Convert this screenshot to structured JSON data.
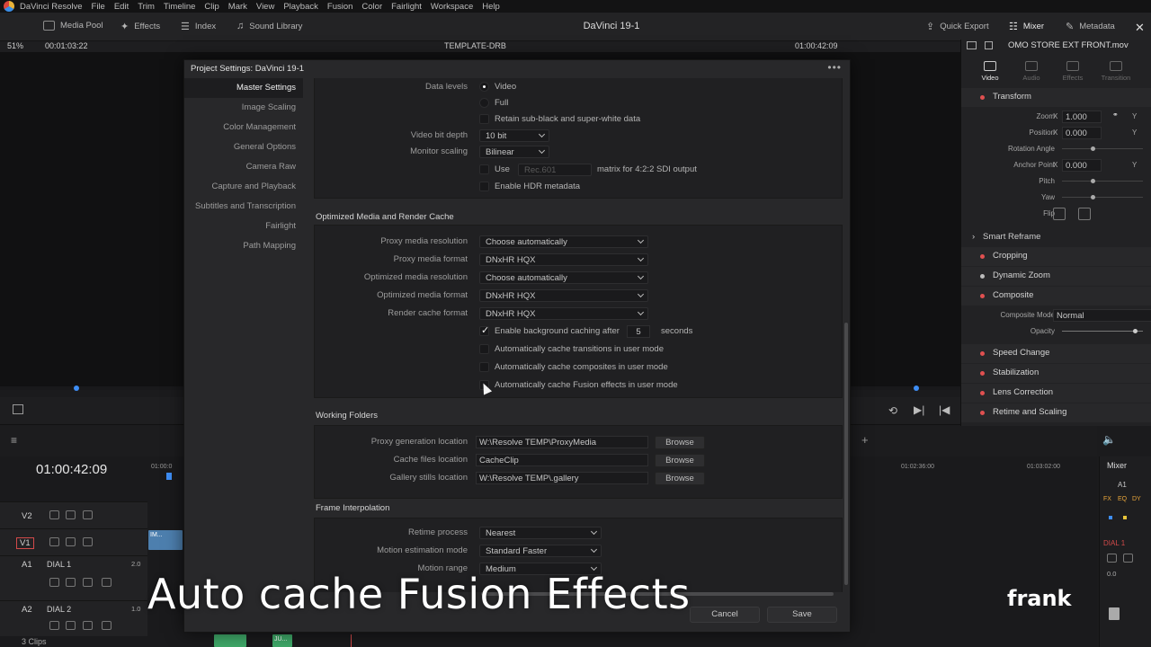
{
  "menubar": {
    "app_name": "DaVinci Resolve",
    "items": [
      "File",
      "Edit",
      "Trim",
      "Timeline",
      "Clip",
      "Mark",
      "View",
      "Playback",
      "Fusion",
      "Color",
      "Fairlight",
      "Workspace",
      "Help"
    ]
  },
  "toolbar": {
    "media_pool": "Media Pool",
    "effects": "Effects",
    "index": "Index",
    "sound_library": "Sound Library",
    "project_title": "DaVinci 19-1",
    "quick_export": "Quick Export",
    "mixer": "Mixer",
    "metadata": "Metadata"
  },
  "viewer": {
    "zoom": "51%",
    "timecode_left": "00:01:03:22",
    "timeline_name": "TEMPLATE-DRB",
    "timecode_right": "01:00:42:09",
    "clip_name": "OMO STORE EXT FRONT.mov"
  },
  "inspector": {
    "tabs": [
      "Video",
      "Audio",
      "Effects",
      "Transition"
    ],
    "transform": "Transform",
    "zoom_label": "Zoom",
    "zoom_x": "1.000",
    "position_label": "Position",
    "position_x": "0.000",
    "rotation_label": "Rotation Angle",
    "anchor_label": "Anchor Point",
    "anchor_x": "0.000",
    "pitch_label": "Pitch",
    "yaw_label": "Yaw",
    "flip_label": "Flip",
    "x_label": "X",
    "y_label": "Y",
    "smart_reframe": "Smart Reframe",
    "cropping": "Cropping",
    "dynamic_zoom": "Dynamic Zoom",
    "composite": "Composite",
    "composite_mode_label": "Composite Mode",
    "composite_mode": "Normal",
    "opacity_label": "Opacity",
    "speed_change": "Speed Change",
    "stabilization": "Stabilization",
    "lens_correction": "Lens Correction",
    "retime_scaling": "Retime and Scaling"
  },
  "timeline": {
    "timecode": "01:00:42:09",
    "ruler": [
      "01:00:0",
      "01:02:36:00",
      "01:03:02:00"
    ],
    "tracks": {
      "v2": "V2",
      "v1": "V1",
      "a1": "A1",
      "a1_name": "DIAL 1",
      "a1_level": "2.0",
      "a2": "A2",
      "a2_name": "DIAL 2",
      "a2_level": "1.0",
      "clips_count": "3 Clips"
    },
    "clip_label": "IM...",
    "audio_clip_label": "JU..."
  },
  "mixer": {
    "title": "Mixer",
    "channel": "A1",
    "fx": [
      "FX",
      "EQ",
      "DY"
    ],
    "track": "DIAL 1",
    "level": "0.0"
  },
  "dialog": {
    "title": "Project Settings:  DaVinci 19-1",
    "menu_glyph": "•••",
    "nav": [
      "Master Settings",
      "Image Scaling",
      "Color Management",
      "General Options",
      "Camera Raw",
      "Capture and Playback",
      "Subtitles and Transcription",
      "Fairlight",
      "Path Mapping"
    ],
    "video_io": {
      "data_levels_label": "Data levels",
      "data_levels_video": "Video",
      "data_levels_full": "Full",
      "retain_label": "Retain sub-black and super-white data",
      "bit_depth_label": "Video bit depth",
      "bit_depth": "10 bit",
      "monitor_scaling_label": "Monitor scaling",
      "monitor_scaling": "Bilinear",
      "use_label": "Use",
      "use_value": "Rec.601",
      "matrix_label": "matrix for 4:2:2 SDI output",
      "hdr_label": "Enable HDR metadata"
    },
    "optimized": {
      "title": "Optimized Media and Render Cache",
      "proxy_res_label": "Proxy media resolution",
      "proxy_res": "Choose automatically",
      "proxy_fmt_label": "Proxy media format",
      "proxy_fmt": "DNxHR HQX",
      "opt_res_label": "Optimized media resolution",
      "opt_res": "Choose automatically",
      "opt_fmt_label": "Optimized media format",
      "opt_fmt": "DNxHR HQX",
      "render_fmt_label": "Render cache format",
      "render_fmt": "DNxHR HQX",
      "bg_cache_label": "Enable background caching after",
      "bg_cache_value": "5",
      "bg_cache_unit": "seconds",
      "auto_transitions": "Automatically cache transitions in user mode",
      "auto_composites": "Automatically cache composites in user mode",
      "auto_fusion": "Automatically cache Fusion effects in user mode"
    },
    "folders": {
      "title": "Working Folders",
      "proxy_loc_label": "Proxy generation location",
      "proxy_loc": "W:\\Resolve TEMP\\ProxyMedia",
      "cache_loc_label": "Cache files location",
      "cache_loc": "CacheClip",
      "gallery_loc_label": "Gallery stills location",
      "gallery_loc": "W:\\Resolve TEMP\\.gallery",
      "browse": "Browse"
    },
    "interp": {
      "title": "Frame Interpolation",
      "retime_label": "Retime process",
      "retime": "Nearest",
      "motion_mode_label": "Motion estimation mode",
      "motion_mode": "Standard Faster",
      "motion_range_label": "Motion range",
      "motion_range": "Medium"
    },
    "cancel": "Cancel",
    "save": "Save"
  },
  "overlay": {
    "caption": "Auto cache Fusion Effects",
    "brand": "frank"
  }
}
